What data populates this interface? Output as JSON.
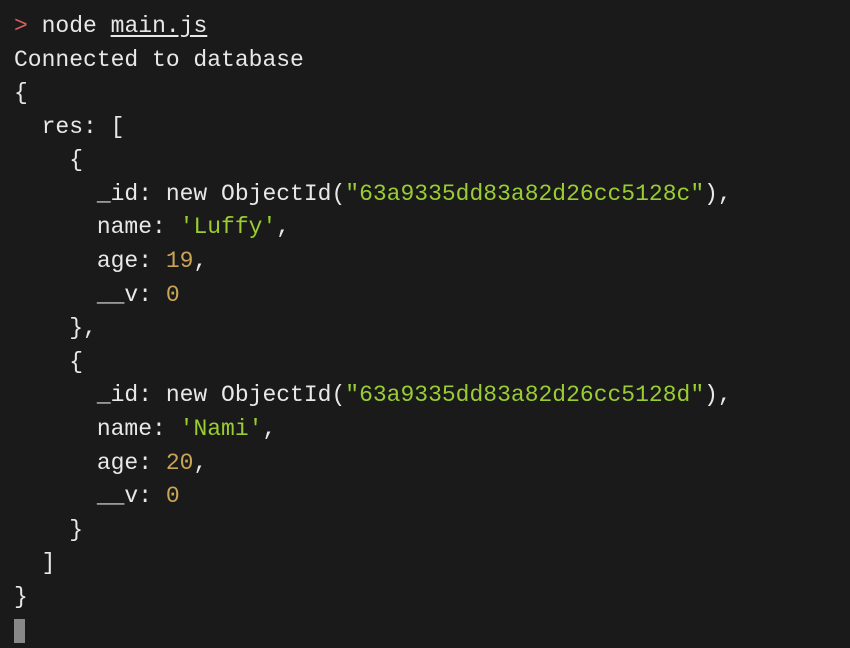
{
  "prompt": {
    "symbol": ">",
    "command_bin": "node",
    "command_arg": "main.js"
  },
  "output": {
    "connected_msg": "Connected to database",
    "open_brace": "{",
    "res_key": "  res: [",
    "obj1_open": "    {",
    "obj1_id_prefix": "      _id: new ObjectId(",
    "obj1_id_value": "\"63a9335dd83a82d26cc5128c\"",
    "obj1_id_suffix": "),",
    "obj1_name_key": "      name: ",
    "obj1_name_val": "'Luffy'",
    "obj1_name_suffix": ",",
    "obj1_age_key": "      age: ",
    "obj1_age_val": "19",
    "obj1_age_suffix": ",",
    "obj1_v_key": "      __v: ",
    "obj1_v_val": "0",
    "obj1_close": "    },",
    "obj2_open": "    {",
    "obj2_id_prefix": "      _id: new ObjectId(",
    "obj2_id_value": "\"63a9335dd83a82d26cc5128d\"",
    "obj2_id_suffix": "),",
    "obj2_name_key": "      name: ",
    "obj2_name_val": "'Nami'",
    "obj2_name_suffix": ",",
    "obj2_age_key": "      age: ",
    "obj2_age_val": "20",
    "obj2_age_suffix": ",",
    "obj2_v_key": "      __v: ",
    "obj2_v_val": "0",
    "obj2_close": "    }",
    "array_close": "  ]",
    "close_brace": "}"
  }
}
